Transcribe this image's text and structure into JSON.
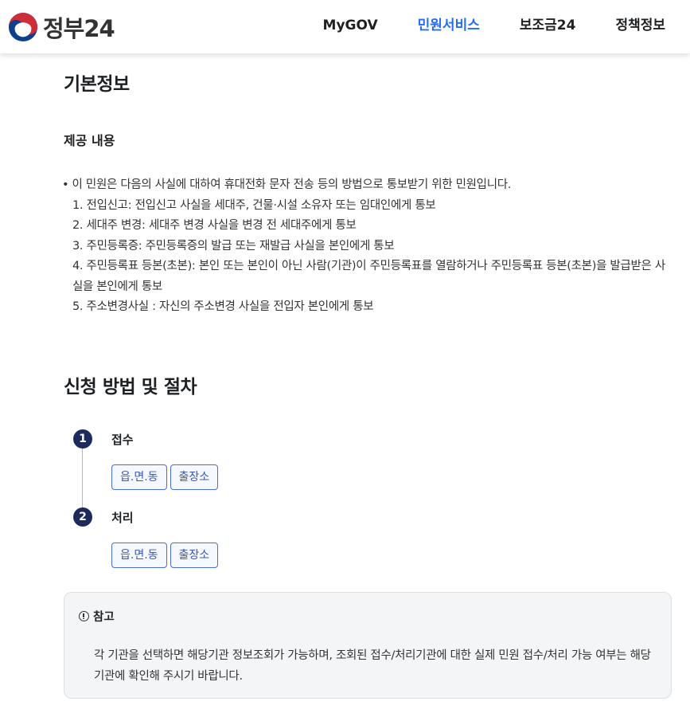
{
  "header": {
    "logo_text": "정부24",
    "nav": [
      {
        "label": "MyGOV",
        "active": false
      },
      {
        "label": "민원서비스",
        "active": true
      },
      {
        "label": "보조금24",
        "active": false
      },
      {
        "label": "정책정보",
        "active": false
      }
    ]
  },
  "basic_info": {
    "title": "기본정보",
    "subtitle": "제공 내용",
    "intro": "• 이 민원은 다음의 사실에 대하여 휴대전화 문자 전송 등의 방법으로 통보받기 위한 민원입니다.",
    "items": [
      "1. 전입신고: 전입신고 사실을 세대주, 건물·시설 소유자 또는 임대인에게 통보",
      "2. 세대주 변경: 세대주 변경 사실을 변경 전 세대주에게 통보",
      "3. 주민등록증: 주민등록증의 발급 또는 재발급 사실을 본인에게 통보",
      "4. 주민등록표 등본(초본): 본인 또는 본인이 아닌 사람(기관)이 주민등록표를 열람하거나 주민등록표 등본(초본)을 발급받은 사실을 본인에게 통보",
      "5. 주소변경사실 : 자신의 주소변경 사실을 전입자 본인에게 통보"
    ]
  },
  "procedure": {
    "title": "신청 방법 및 절차",
    "steps": [
      {
        "number": "1",
        "label": "접수",
        "chips": [
          "읍.면.동",
          "출장소"
        ]
      },
      {
        "number": "2",
        "label": "처리",
        "chips": [
          "읍.면.동",
          "출장소"
        ]
      }
    ]
  },
  "note": {
    "title": "참고",
    "body": "각 기관을 선택하면 해당기관 정보조회가 가능하며, 조회된 접수/처리기관에 대한 실제 민원 접수/처리 가능 여부는 해당기관에 확인해 주시기 바랍니다."
  },
  "colors": {
    "accent": "#256ef4",
    "step_circle": "#1d2b5c",
    "chip_border": "#4a6cd4",
    "logo_red": "#cd2e3a",
    "logo_blue": "#0f3e8c"
  }
}
